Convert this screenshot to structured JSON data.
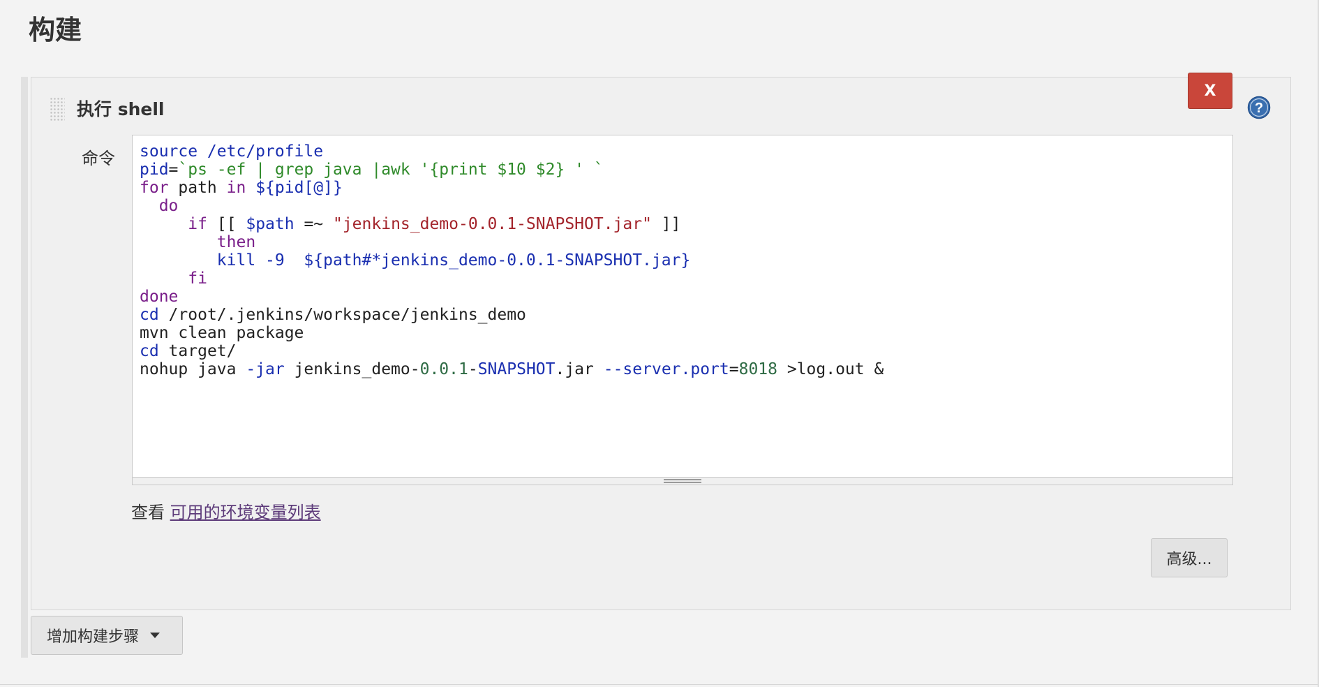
{
  "section": {
    "title": "构建"
  },
  "step": {
    "title": "执行 shell",
    "delete_label": "X",
    "command_label": "命令",
    "code_lines": [
      "source /etc/profile",
      "pid=`ps -ef | grep java |awk '{print $10 $2} ' `",
      "for path in ${pid[@]}",
      "  do",
      "     if [[ $path =~ \"jenkins_demo-0.0.1-SNAPSHOT.jar\" ]]",
      "        then",
      "        kill -9  ${path#*jenkins_demo-0.0.1-SNAPSHOT.jar}",
      "     fi",
      "done",
      "cd /root/.jenkins/workspace/jenkins_demo",
      "mvn clean package",
      "cd target/",
      "nohup java -jar jenkins_demo-0.0.1-SNAPSHOT.jar --server.port=8018 >log.out &"
    ],
    "env_prefix": "查看",
    "env_link": "可用的环境变量列表",
    "advanced_label": "高级..."
  },
  "add_step": {
    "label": "增加构建步骤"
  },
  "colors": {
    "delete": "#c9463a",
    "help": "#3a6fb0",
    "link": "#5d3b7a"
  },
  "icons": {
    "help": "question-circle-icon",
    "drag": "drag-handle-icon",
    "caret": "caret-down-icon"
  }
}
